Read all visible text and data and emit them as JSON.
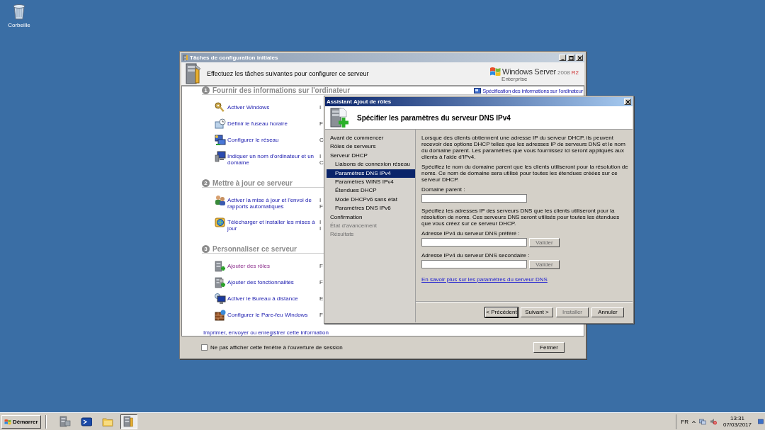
{
  "desktop_icons": [
    {
      "label": "Corbeille"
    }
  ],
  "setup_window": {
    "title": "Tâches de configuration initiales",
    "heading": "Effectuez les tâches suivantes pour configurer ce serveur",
    "logo": {
      "brand": "Windows Server",
      "version": "2008",
      "release": "R2",
      "edition": "Enterprise"
    },
    "side_link": "Spécification des informations sur l'ordinateur",
    "sections": [
      {
        "number": "1",
        "title": "Fournir des informations sur l'ordinateur",
        "tasks": [
          {
            "kind": "key",
            "label": "Activer Windows",
            "note": [
              "I"
            ],
            "visited": false
          },
          {
            "kind": "clock",
            "label": "Définir le fuseau horaire",
            "note": [
              "F"
            ],
            "visited": false
          },
          {
            "kind": "network",
            "label": "Configurer le réseau",
            "note": [
              "C"
            ],
            "visited": false
          },
          {
            "kind": "computer",
            "label": "Indiquer un nom d'ordinateur et un domaine",
            "note": [
              "I",
              "C"
            ],
            "visited": false
          }
        ]
      },
      {
        "number": "2",
        "title": "Mettre à jour ce serveur",
        "tasks": [
          {
            "kind": "users",
            "label": "Activer la mise à jour et l'envoi de rapports automatiques",
            "note": [
              "I",
              "F"
            ],
            "visited": false
          },
          {
            "kind": "update",
            "label": "Télécharger et installer les mises à jour",
            "note": [
              "I",
              "I"
            ],
            "visited": false
          }
        ]
      },
      {
        "number": "3",
        "title": "Personnaliser ce serveur",
        "tasks": [
          {
            "kind": "roles",
            "label": "Ajouter des rôles",
            "note": [
              "F"
            ],
            "visited": true
          },
          {
            "kind": "features",
            "label": "Ajouter des fonctionnalités",
            "note": [
              "F"
            ],
            "visited": false
          },
          {
            "kind": "remote",
            "label": "Activer le Bureau à distance",
            "note": [
              "E"
            ],
            "visited": false
          },
          {
            "kind": "firewall",
            "label": "Configurer le Pare-feu Windows",
            "note": [
              "F"
            ],
            "visited": false
          }
        ]
      }
    ],
    "print_link": "Imprimer, envoyer ou enregistrer cette information",
    "footer": {
      "checkbox_label": "Ne pas afficher cette fenêtre à l'ouverture de session",
      "checked": false,
      "close_button": "Fermer"
    }
  },
  "wizard": {
    "title": "Assistant Ajout de rôles",
    "heading": "Spécifier les paramètres du serveur DNS IPv4",
    "steps": [
      {
        "label": "Avant de commencer",
        "selected": false,
        "disabled": false
      },
      {
        "label": "Rôles de serveurs",
        "selected": false,
        "disabled": false
      },
      {
        "label": "Serveur DHCP",
        "selected": false,
        "disabled": false,
        "children": [
          {
            "label": "Liaisons de connexion réseau",
            "selected": false,
            "disabled": false
          },
          {
            "label": "Paramètres DNS IPv4",
            "selected": true,
            "disabled": false
          },
          {
            "label": "Paramètres WINS IPv4",
            "selected": false,
            "disabled": false
          },
          {
            "label": "Étendues DHCP",
            "selected": false,
            "disabled": false
          },
          {
            "label": "Mode DHCPv6 sans état",
            "selected": false,
            "disabled": false
          },
          {
            "label": "Paramètres DNS IPv6",
            "selected": false,
            "disabled": false
          }
        ]
      },
      {
        "label": "Confirmation",
        "selected": false,
        "disabled": false
      },
      {
        "label": "État d'avancement",
        "selected": false,
        "disabled": true
      },
      {
        "label": "Résultats",
        "selected": false,
        "disabled": true
      }
    ],
    "content": [
      {
        "kind": "paragraph",
        "text": "Lorsque des clients obtiennent une adresse IP du serveur DHCP, ils peuvent recevoir des options DHCP telles que les adresses IP de serveurs DNS et le nom du domaine parent. Les paramètres que vous fournissez ici seront appliqués aux clients à l'aide d'IPv4."
      },
      {
        "kind": "paragraph",
        "text": "Spécifiez le nom du domaine parent que les clients utiliseront pour la résolution de noms. Ce nom de domaine sera utilisé pour toutes les étendues créées sur ce serveur DHCP."
      },
      {
        "kind": "field",
        "label": "Domaine parent :"
      },
      {
        "kind": "paragraph",
        "text": "Spécifiez les adresses IP des serveurs DNS que les clients utiliseront pour la résolution de noms. Ces serveurs DNS seront utilisés pour toutes les étendues que vous créez sur ce serveur DHCP."
      },
      {
        "kind": "field",
        "label": "Adresse IPv4 du serveur DNS préféré :",
        "button": {
          "label": "Valider",
          "disabled": true
        }
      },
      {
        "kind": "field",
        "label": "Adresse IPv4 du serveur DNS secondaire :",
        "button": {
          "label": "Valider",
          "disabled": true
        }
      },
      {
        "kind": "link",
        "text": "En savoir plus sur les paramètres du serveur DNS"
      }
    ],
    "buttons": [
      {
        "label": "< Précédent",
        "disabled": false,
        "focused": true
      },
      {
        "label": "Suivant >",
        "disabled": false,
        "focused": false
      },
      {
        "label": "Installer",
        "disabled": true,
        "focused": false
      },
      {
        "label": "Annuler",
        "disabled": false,
        "focused": false
      }
    ]
  },
  "taskbar": {
    "start": "Démarrer",
    "quick_launch": [
      {
        "kind": "server"
      },
      {
        "kind": "shell"
      },
      {
        "kind": "folder"
      }
    ],
    "windows": [
      {
        "kind": "tasks",
        "selected": true
      }
    ],
    "language": "FR",
    "clock": {
      "time": "13:31",
      "date": "07/03/2017"
    }
  }
}
